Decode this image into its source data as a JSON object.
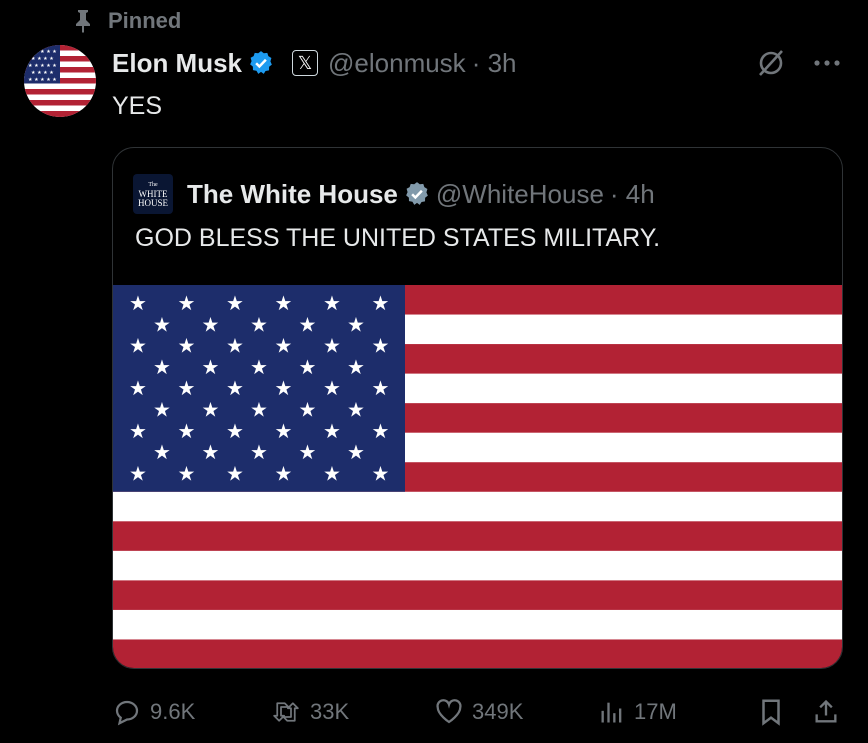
{
  "pinned": {
    "label": "Pinned",
    "icon": "pin-icon"
  },
  "author": {
    "name": "Elon Musk",
    "handle": "@elonmusk",
    "time": "· 3h",
    "affiliate_badge": "𝕏",
    "verified_color": "#1d9bf0"
  },
  "tweet": {
    "text": "YES"
  },
  "quoted": {
    "name": "The White House",
    "handle": "@WhiteHouse",
    "time": "· 4h",
    "text": "GOD BLESS THE UNITED STATES MILITARY.",
    "logo_lines": [
      "The",
      "WHITE",
      "HOUSE"
    ],
    "verified_color": "#829aab"
  },
  "actions": {
    "replies": "9.6K",
    "reposts": "33K",
    "likes": "349K",
    "views": "17M"
  },
  "colors": {
    "flag_red": "#b22234",
    "flag_blue": "#1d2d6b",
    "muted": "#71767b",
    "border": "#2f3336"
  }
}
